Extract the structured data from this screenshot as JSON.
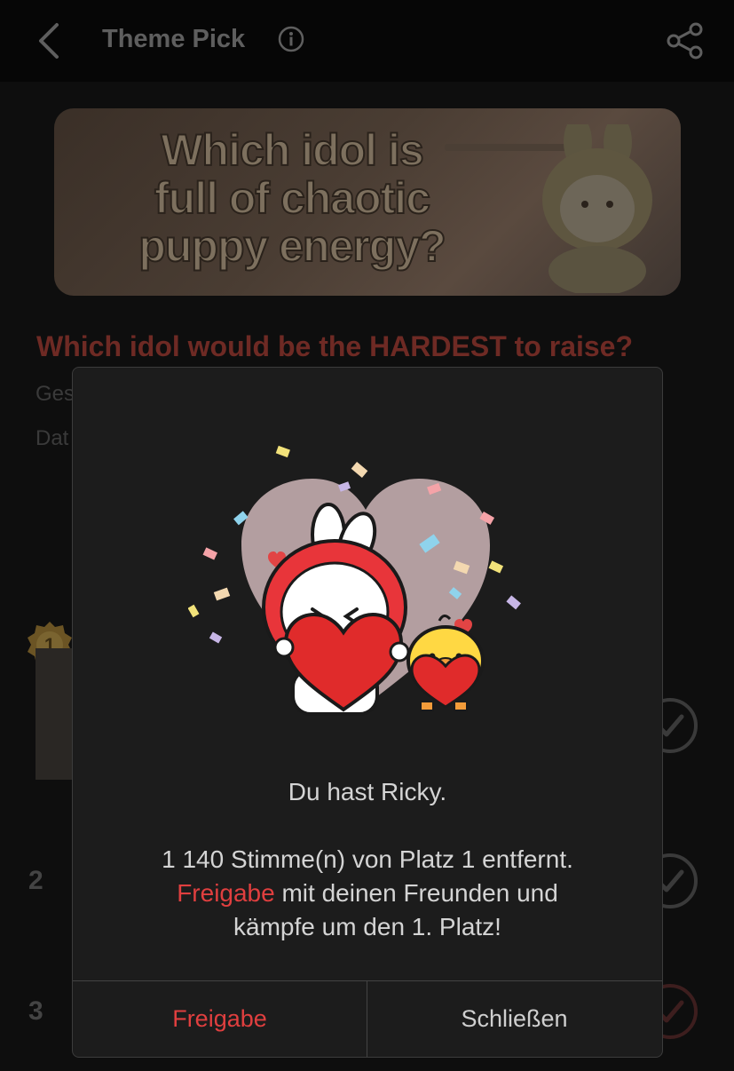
{
  "header": {
    "title": "Theme Pick"
  },
  "banner": {
    "lines": [
      "Which idol is",
      "full of chaotic",
      "puppy energy?"
    ]
  },
  "content": {
    "question": "Which idol would be the HARDEST to raise?",
    "meta_1": "Ges",
    "meta_2": "Dat"
  },
  "ranking": {
    "first_badge": "1",
    "second": "2",
    "third": "3"
  },
  "modal": {
    "line_1": "Du hast Ricky.",
    "line_2": "1 140 Stimme(n) von Platz 1 entfernt.",
    "line_3_accent": "Freigabe",
    "line_3_rest": " mit deinen Freunden und",
    "line_4": "kämpfe um den 1. Platz!",
    "share_button": "Freigabe",
    "close_button": "Schließen"
  },
  "colors": {
    "accent": "#e03f3f",
    "modal_bg": "#1c1c1c",
    "page_bg": "#0e0e0e"
  },
  "icons": [
    "back-arrow-icon",
    "info-icon",
    "share-icon",
    "checkmark-icon",
    "medal-icon"
  ]
}
